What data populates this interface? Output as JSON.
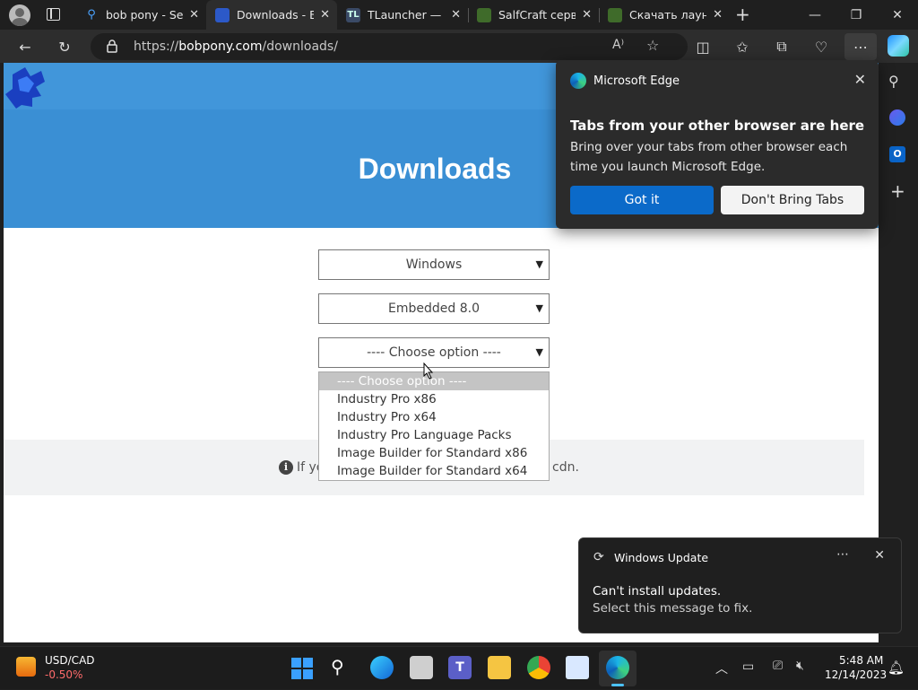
{
  "tabs": [
    {
      "title": "bob pony - Sea",
      "active": false
    },
    {
      "title": "Downloads - B",
      "active": true
    },
    {
      "title": "TLauncher — C",
      "active": false
    },
    {
      "title": "SalfCraft серве",
      "active": false
    },
    {
      "title": "Скачать лаунч",
      "active": false
    }
  ],
  "address": {
    "scheme": "https://",
    "host": "bobpony.com",
    "path": "/downloads/"
  },
  "page": {
    "title": "Downloads",
    "selects": [
      "Windows",
      "Embedded 8.0",
      "---- Choose option ----"
    ],
    "info_text": "If yo",
    "info_tail": "cdn."
  },
  "dropdown": {
    "options": [
      "---- Choose option ----",
      "Industry Pro x86",
      "Industry Pro x64",
      "Industry Pro Language Packs",
      "Image Builder for Standard x86",
      "Image Builder for Standard x64"
    ],
    "highlighted": 0
  },
  "popup": {
    "app": "Microsoft Edge",
    "heading": "Tabs from your other browser are here",
    "body": "Bring over your tabs from other browser each time you launch Microsoft Edge.",
    "primary": "Got it",
    "secondary": "Don't Bring Tabs"
  },
  "toast": {
    "app": "Windows Update",
    "line1": "Can't install updates.",
    "line2": "Select this message to fix."
  },
  "taskbar": {
    "widget_title": "USD/CAD",
    "widget_value": "-0.50%",
    "time": "5:48 AM",
    "date": "12/14/2023"
  },
  "colors": {
    "hero": "#3a8fd4",
    "accent": "#0b6ac9",
    "widget_down": "#ff6b6b"
  }
}
